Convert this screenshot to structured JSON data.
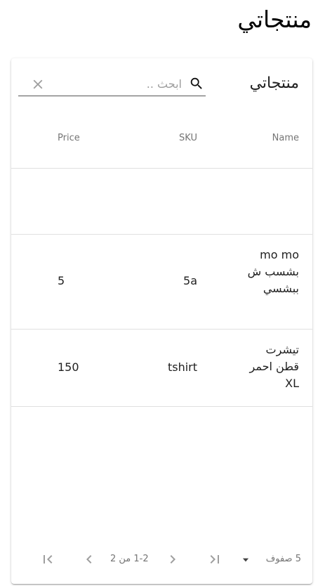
{
  "page": {
    "title": "منتجاتي"
  },
  "table": {
    "title": "منتجاتي",
    "search": {
      "placeholder": "ابحث ..",
      "value": ""
    },
    "columns": {
      "name": "Name",
      "sku": "SKU",
      "price": "Price"
    },
    "rows": [
      {
        "name": "mo mo بشسب ش ببشسي",
        "sku": "5a",
        "price": "5"
      },
      {
        "name": "تيشرت قطن احمر XL",
        "sku": "tshirt",
        "price": "150"
      }
    ]
  },
  "pagination": {
    "rows_label": "5 صفوف",
    "range_label": "1-2 من 2"
  },
  "icons": {
    "search": "search-icon",
    "clear": "close-icon",
    "dropdown": "arrow-drop-down-icon",
    "first": "first-page-icon",
    "prev": "chevron-left-icon",
    "next": "chevron-right-icon",
    "last": "last-page-icon"
  }
}
